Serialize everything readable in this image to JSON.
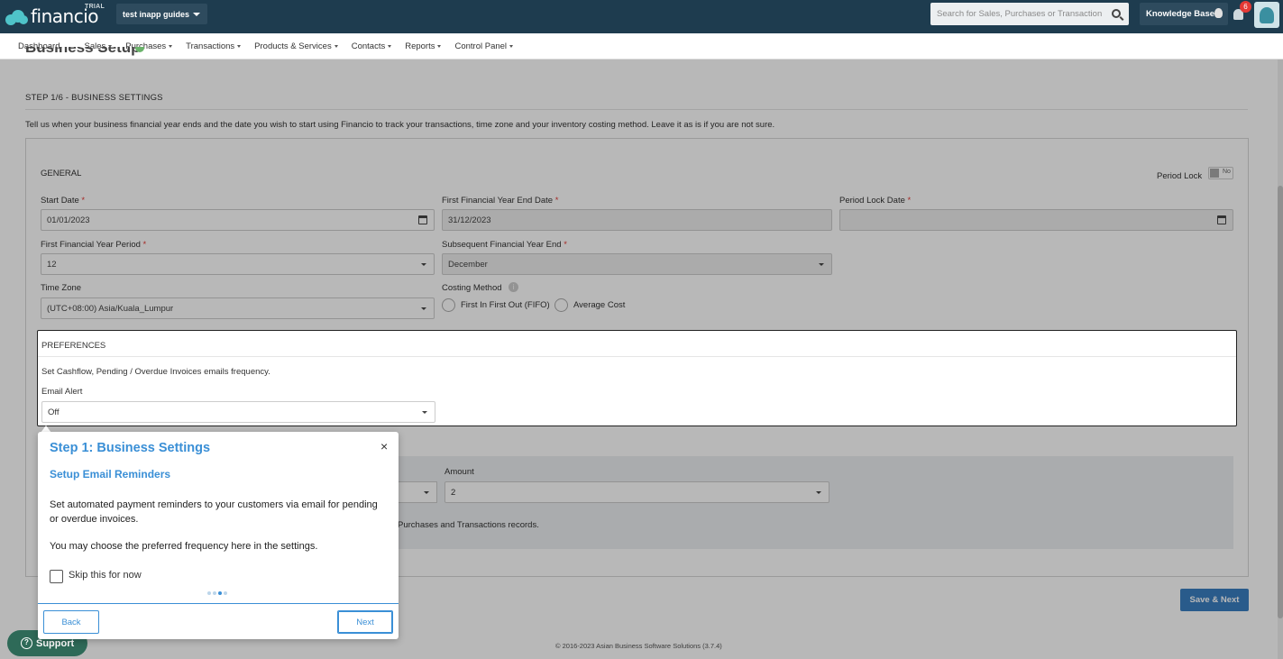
{
  "app": {
    "logo_text": "financio",
    "trial_label": "TRIAL",
    "company_selector": "test inapp guides",
    "search_placeholder": "Search for Sales, Purchases or Transactions",
    "knowledge_base": "Knowledge Base",
    "notification_count": "6"
  },
  "nav": {
    "items": [
      {
        "label": "Dashboard"
      },
      {
        "label": "Sales"
      },
      {
        "label": "Purchases"
      },
      {
        "label": "Transactions"
      },
      {
        "label": "Products & Services"
      },
      {
        "label": "Contacts"
      },
      {
        "label": "Reports"
      },
      {
        "label": "Control Panel"
      }
    ]
  },
  "page": {
    "title": "Business Setup",
    "step_title": "STEP 1/6 - BUSINESS SETTINGS",
    "step_description": "Tell us when your business financial year ends and the date you wish to start using Financio to track your transactions, time zone and your inventory costing method. Leave it as is if you are not sure."
  },
  "general": {
    "title": "GENERAL",
    "period_lock_label": "Period Lock",
    "period_lock_toggle": "No",
    "start_date_label": "Start Date",
    "start_date_value": "01/01/2023",
    "fy_end_label": "First Financial Year End Date",
    "fy_end_value": "31/12/2023",
    "period_lock_date_label": "Period Lock Date",
    "period_lock_date_value": "",
    "fy_period_label": "First Financial Year Period",
    "fy_period_value": "12",
    "subsequent_fy_label": "Subsequent Financial Year End",
    "subsequent_fy_value": "December",
    "timezone_label": "Time Zone",
    "timezone_value": "(UTC+08:00) Asia/Kuala_Lumpur",
    "costing_label": "Costing Method",
    "costing_fifo": "First In First Out (FIFO)",
    "costing_avg": "Average Cost",
    "required_mark": "*"
  },
  "preferences": {
    "title": "PREFERENCES",
    "description": "Set Cashflow, Pending / Overdue Invoices emails frequency.",
    "email_alert_label": "Email Alert",
    "email_alert_value": "Off"
  },
  "decimal": {
    "amount_label": "Amount",
    "amount_value": "2",
    "note_text": "Purchases and Transactions records."
  },
  "actions": {
    "save_next": "Save & Next"
  },
  "footer": {
    "copyright": "© 2016-2023 Asian Business Software Solutions (3.7.4)",
    "support": "Support"
  },
  "tooltip": {
    "title": "Step 1: Business Settings",
    "subtitle": "Setup Email Reminders",
    "paragraph1": "Set automated payment reminders to your customers via email for pending or overdue invoices.",
    "paragraph2": "You may choose the preferred frequency here in the settings.",
    "skip_label": "Skip this for now",
    "back": "Back",
    "next": "Next",
    "close": "×"
  }
}
